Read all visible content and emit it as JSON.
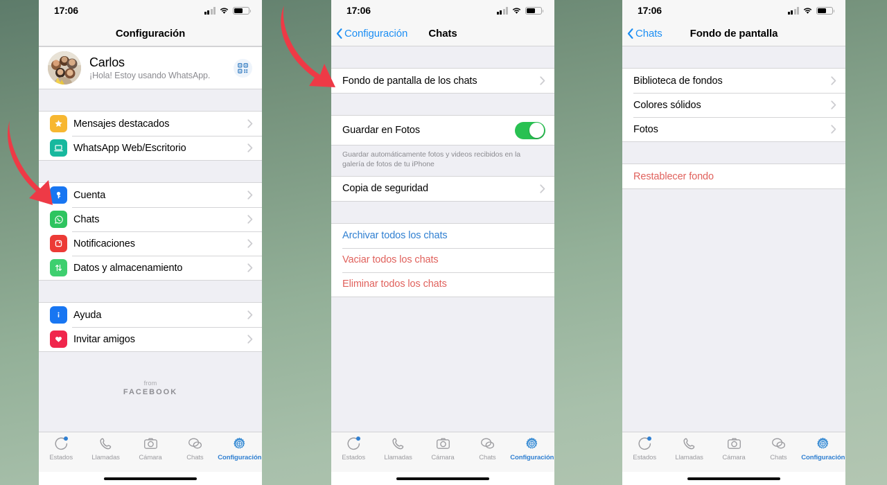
{
  "statusbar": {
    "time": "17:06"
  },
  "phone1": {
    "nav": {
      "title": "Configuración"
    },
    "profile": {
      "name": "Carlos",
      "status": "¡Hola! Estoy usando WhatsApp.",
      "avatar_icon": "family-photo-avatar",
      "qr_icon": "qr-code-icon"
    },
    "group1": [
      {
        "label": "Mensajes destacados",
        "icon": "star-icon",
        "color": "#f7b731"
      },
      {
        "label": "WhatsApp Web/Escritorio",
        "icon": "laptop-icon",
        "color": "#17b89e"
      }
    ],
    "group2": [
      {
        "label": "Cuenta",
        "icon": "key-icon",
        "color": "#1876f2"
      },
      {
        "label": "Chats",
        "icon": "whatsapp-icon",
        "color": "#2ec45f"
      },
      {
        "label": "Notificaciones",
        "icon": "bell-square-icon",
        "color": "#ec3b36"
      },
      {
        "label": "Datos y almacenamiento",
        "icon": "data-arrows-icon",
        "color": "#3ecf6f"
      }
    ],
    "group3": [
      {
        "label": "Ayuda",
        "icon": "info-icon",
        "color": "#1876f2"
      },
      {
        "label": "Invitar amigos",
        "icon": "heart-icon",
        "color": "#f0264c"
      }
    ],
    "footnote": {
      "from": "from",
      "brand": "FACEBOOK"
    }
  },
  "phone2": {
    "nav": {
      "back": "Configuración",
      "title": "Chats"
    },
    "group1": [
      {
        "label": "Fondo de pantalla de los chats"
      }
    ],
    "toggle_row": {
      "label": "Guardar en Fotos",
      "value": "on"
    },
    "hint": "Guardar automáticamente fotos y videos recibidos en la galería de fotos de tu iPhone",
    "group2": [
      {
        "label": "Copia de seguridad"
      }
    ],
    "actions": [
      {
        "label": "Archivar todos los chats",
        "style": "blue"
      },
      {
        "label": "Vaciar todos los chats",
        "style": "red"
      },
      {
        "label": "Eliminar todos los chats",
        "style": "red"
      }
    ]
  },
  "phone3": {
    "nav": {
      "back": "Chats",
      "title": "Fondo de pantalla"
    },
    "group1": [
      {
        "label": "Biblioteca de fondos"
      },
      {
        "label": "Colores sólidos"
      },
      {
        "label": "Fotos"
      }
    ],
    "actions": [
      {
        "label": "Restablecer fondo",
        "style": "red"
      }
    ]
  },
  "tabbar": {
    "items": [
      {
        "label": "Estados",
        "icon": "status-ring-icon",
        "active": false
      },
      {
        "label": "Llamadas",
        "icon": "phone-icon",
        "active": false
      },
      {
        "label": "Cámara",
        "icon": "camera-icon",
        "active": false
      },
      {
        "label": "Chats",
        "icon": "chat-bubbles-icon",
        "active": false
      },
      {
        "label": "Configuración",
        "icon": "gear-icon",
        "active": true
      }
    ]
  },
  "annotations": {
    "arrow1": "red-arrow-pointing-to-chats",
    "arrow2": "red-arrow-pointing-to-wallpaper"
  },
  "colors": {
    "accent_blue": "#2f7fd1",
    "link_blue": "#1c8ef3",
    "danger_red": "#e0615c",
    "toggle_green": "#29c152",
    "arrow_red": "#ee3a46",
    "background_green_top": "#5d7b6a",
    "background_green_bottom": "#b3c6b2"
  }
}
